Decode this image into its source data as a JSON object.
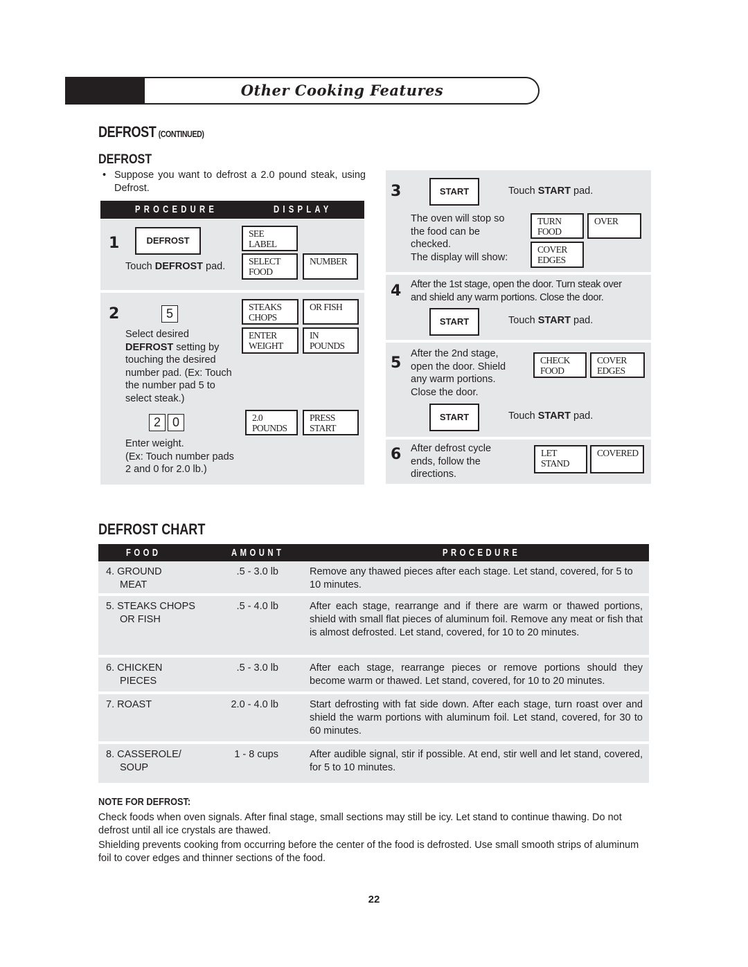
{
  "banner": {
    "title": "Other Cooking Features"
  },
  "section": {
    "title": "DEFROST",
    "title_suffix": "(CONTINUED)",
    "subtitle": "DEFROST"
  },
  "intro": {
    "bullet": "•",
    "text": "Suppose you want to defrost a 2.0 pound steak, using Defrost."
  },
  "procedure_table": {
    "header": {
      "procedure": "PROCEDURE",
      "display": "DISPLAY"
    },
    "steps": [
      {
        "number": "1",
        "pad": "DEFROST",
        "text_pre": "Touch ",
        "text_bold": "DEFROST",
        "text_post": " pad.",
        "displays": [
          [
            "SEE",
            "LABEL"
          ],
          [
            "SELECT",
            "FOOD"
          ],
          [
            "NUMBER",
            ""
          ]
        ]
      },
      {
        "number": "2",
        "key": "5",
        "text_bold": "DEFROST",
        "text_l1": "Select desired",
        "text_l2_post": " setting by",
        "text_l3": "touching the desired",
        "text_l4": "number pad. (Ex: Touch",
        "text_l5": "the number pad 5   to",
        "text_l6": "select steak.)",
        "displays": [
          [
            "STEAKS",
            "CHOPS"
          ],
          [
            "OR FISH",
            ""
          ],
          [
            "ENTER",
            "WEIGHT"
          ],
          [
            "IN",
            "POUNDS"
          ]
        ],
        "weight_keys": [
          "2",
          "0"
        ],
        "weight_displays": [
          [
            "2.0",
            "POUNDS"
          ],
          [
            "PRESS",
            "START"
          ]
        ],
        "weight_l1": "Enter weight.",
        "weight_l2": "(Ex: Touch number pads",
        "weight_l3": "2   and 0   for 2.0 lb.)"
      },
      {
        "number": "3",
        "pad": "START",
        "touch_pre": "Touch ",
        "touch_bold": "START",
        "touch_post": " pad.",
        "text_l1": "The oven will stop so",
        "text_l2": "the food can be",
        "text_l3": "checked.",
        "text_l4": "The display will show:",
        "displays": [
          [
            "TURN",
            "FOOD"
          ],
          [
            "OVER",
            ""
          ],
          [
            "COVER",
            "EDGES"
          ]
        ]
      },
      {
        "number": "4",
        "text_l1": "After the 1st stage, open the door. Turn steak over",
        "text_l2": "and shield any warm portions. Close the door.",
        "pad": "START",
        "touch_pre": "Touch ",
        "touch_bold": "START",
        "touch_post": " pad."
      },
      {
        "number": "5",
        "text_l1": "After the 2nd stage,",
        "text_l2": "open the door. Shield",
        "text_l3": "any warm portions.",
        "text_l4": "Close the door.",
        "displays": [
          [
            "CHECK",
            "FOOD"
          ],
          [
            "COVER",
            "EDGES"
          ]
        ],
        "pad": "START",
        "touch_pre": "Touch ",
        "touch_bold": "START",
        "touch_post": " pad."
      },
      {
        "number": "6",
        "text_l1": "After defrost cycle",
        "text_l2": "ends, follow the",
        "text_l3": "directions.",
        "displays": [
          [
            "LET",
            "STAND"
          ],
          [
            "COVERED",
            ""
          ]
        ]
      }
    ]
  },
  "chart": {
    "title": "DEFROST CHART",
    "headers": {
      "food": "FOOD",
      "amount": "AMOUNT",
      "procedure": "PROCEDURE"
    },
    "rows": [
      {
        "food_l1": "4. GROUND",
        "food_l2": "MEAT",
        "amount": ".5  -  3.0 lb",
        "procedure": "Remove any thawed pieces after each stage. Let stand, covered, for 5 to 10 minutes."
      },
      {
        "food_l1": "5. STEAKS CHOPS",
        "food_l2": "OR FISH",
        "amount": ".5  -  4.0 lb",
        "procedure": "After each stage, rearrange and if there are warm or thawed portions, shield with small flat pieces of aluminum foil. Remove any meat or fish that is almost defrosted. Let stand, covered, for 10 to 20 minutes."
      },
      {
        "food_l1": "6. CHICKEN",
        "food_l2": "PIECES",
        "amount": ".5  -  3.0 lb",
        "procedure": "After each stage, rearrange pieces or remove portions should they become warm or thawed. Let stand, covered, for 10 to 20 minutes."
      },
      {
        "food_l1": "7. ROAST",
        "food_l2": "",
        "amount": "2.0  -  4.0 lb",
        "procedure": "Start defrosting with fat side down. After each stage, turn roast over and shield the warm portions with aluminum foil. Let stand, covered, for 30 to 60 minutes."
      },
      {
        "food_l1": "8. CASSEROLE/",
        "food_l2": "SOUP",
        "amount": "1  -  8 cups",
        "procedure": "After audible signal, stir if possible. At end, stir well and let stand, covered, for 5 to 10 minutes."
      }
    ]
  },
  "note": {
    "title": "NOTE FOR DEFROST:",
    "paragraphs": [
      "Check foods when oven signals. After final stage, small sections may still be icy. Let stand to continue thawing. Do not defrost until all ice crystals are thawed.",
      "Shielding prevents cooking from occurring before the center of the food is defrosted. Use small smooth strips of aluminum foil to cover edges and thinner sections of the food."
    ]
  },
  "page_number": "22"
}
